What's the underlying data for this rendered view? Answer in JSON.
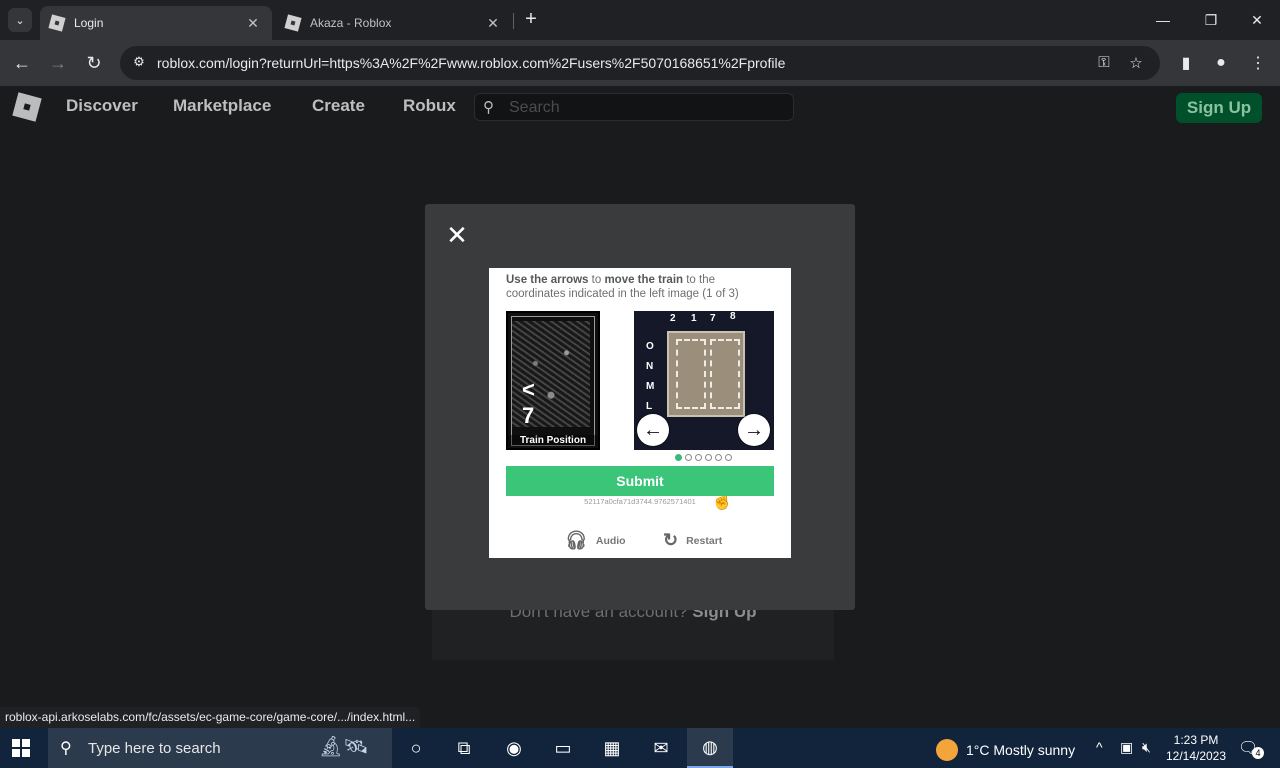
{
  "browser": {
    "tabs": [
      {
        "title": "Login",
        "active": true
      },
      {
        "title": "Akaza - Roblox",
        "active": false
      }
    ],
    "url_host": "roblox.com",
    "url_rest": "/login?returnUrl=https%3A%2F%2Fwww.roblox.com%2Fusers%2F5070168651%2Fprofile",
    "status_url": "roblox-api.arkoselabs.com/fc/assets/ec-game-core/game-core/.../index.html..."
  },
  "roblox": {
    "nav": [
      "Discover",
      "Marketplace",
      "Create",
      "Robux"
    ],
    "search_placeholder": "Search",
    "signup": "Sign Up",
    "behind_text": "Don't have an account?",
    "behind_link": "Sign Up"
  },
  "captcha": {
    "instr_1": "Use the arrows",
    "instr_2": " to ",
    "instr_3": "move the train",
    "instr_4": " to the coordinates indicated in the left image (1 of 3)",
    "left_label": "Train Position",
    "left_glyphs": "< 7",
    "top_coords": [
      "2",
      "1",
      "7",
      "8"
    ],
    "side_coords": [
      "O",
      "N",
      "M",
      "L"
    ],
    "dots_total": 6,
    "dots_active": 1,
    "submit": "Submit",
    "session_id": "52117a0cfa71d3744.9762571401",
    "audio": "Audio",
    "restart": "Restart"
  },
  "taskbar": {
    "search_text": "Type here to search",
    "weather": "1°C  Mostly sunny",
    "time": "1:23 PM",
    "date": "12/14/2023",
    "notif_count": "4"
  },
  "colors": {
    "accent_green": "#3ac579",
    "roblox_signup": "#00502c"
  }
}
